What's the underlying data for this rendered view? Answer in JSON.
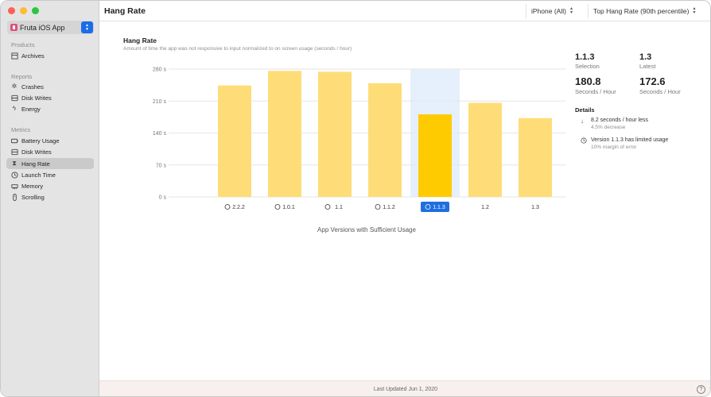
{
  "sidebar": {
    "app_name": "Fruta iOS App",
    "sections": {
      "products": "Products",
      "reports": "Reports",
      "metrics": "Metrics"
    },
    "products": [
      {
        "label": "Archives",
        "icon": "archive-icon"
      }
    ],
    "reports": [
      {
        "label": "Crashes",
        "icon": "crash-icon"
      },
      {
        "label": "Disk Writes",
        "icon": "disk-icon"
      },
      {
        "label": "Energy",
        "icon": "bolt-icon"
      }
    ],
    "metrics": [
      {
        "label": "Battery Usage",
        "icon": "battery-icon"
      },
      {
        "label": "Disk Writes",
        "icon": "disk-icon"
      },
      {
        "label": "Hang Rate",
        "icon": "hourglass-icon",
        "selected": true
      },
      {
        "label": "Launch Time",
        "icon": "clock-icon"
      },
      {
        "label": "Memory",
        "icon": "memory-icon"
      },
      {
        "label": "Scrolling",
        "icon": "scroll-icon"
      }
    ]
  },
  "toolbar": {
    "title": "Hang Rate",
    "device": "iPhone (All)",
    "percentile": "Top Hang Rate (90th percentile)"
  },
  "chart": {
    "title": "Hang Rate",
    "subtitle": "Amount of time the app was not responsive to input normalized to on screen usage (seconds / hour)",
    "x_caption": "App Versions with Sufficient Usage"
  },
  "chart_data": {
    "type": "bar",
    "categories": [
      "2.2.2",
      "1.0.1",
      "1.1",
      "1.1.2",
      "1.1.3",
      "1.2",
      "1.3"
    ],
    "values": [
      244,
      276,
      274,
      249,
      180.8,
      206,
      172.6
    ],
    "yticks": [
      "280 s",
      "210 s",
      "140 s",
      "70 s",
      "0 s"
    ],
    "ylim": [
      0,
      280
    ],
    "selected_index": 4,
    "category_icons": [
      true,
      true,
      true,
      true,
      true,
      false,
      false
    ],
    "colors": {
      "bar": "#fedd78",
      "selected": "#fecb00",
      "highlight": "#e5f0fc",
      "label_selected": "#1f6fe0"
    }
  },
  "stats": {
    "selection_version": "1.1.3",
    "selection_label": "Selection",
    "latest_version": "1.3",
    "latest_label": "Latest",
    "selection_value": "180.8",
    "selection_unit": "Seconds / Hour",
    "latest_value": "172.6",
    "latest_unit": "Seconds / Hour"
  },
  "details": {
    "heading": "Details",
    "items": [
      {
        "icon": "arrow-down-icon",
        "main": "8.2 seconds / hour less",
        "sub": "4.5% decrease"
      },
      {
        "icon": "info-clock-icon",
        "main": "Version 1.1.3 has limited usage",
        "sub": "10% margin of error"
      }
    ]
  },
  "footer": {
    "text": "Last Updated Jun 1, 2020",
    "help": "?"
  }
}
